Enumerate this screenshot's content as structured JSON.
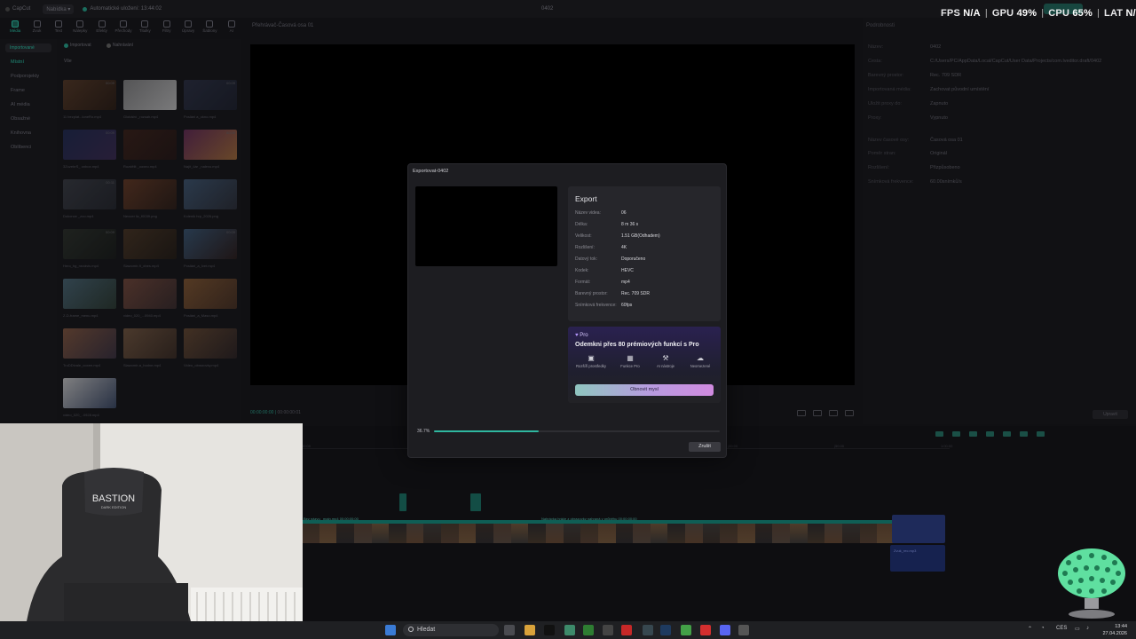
{
  "app": {
    "brand": "CapCut",
    "menu_label": "Nabídka",
    "autosave": "Automatické uložení: 13:44:02",
    "project_name": "0402"
  },
  "perf": {
    "fps_label": "FPS",
    "fps_value": "N/A",
    "gpu_label": "GPU",
    "gpu_value": "49",
    "cpu_label": "CPU",
    "cpu_value": "65",
    "lat_label": "LAT",
    "lat_value": "N/A"
  },
  "toolbar": [
    "Média",
    "Zvuk",
    "Text",
    "Nálepky",
    "Efekty",
    "Přechody",
    "Titulky",
    "Filtry",
    "Úpravy",
    "Šablony",
    "AI"
  ],
  "leftnav": {
    "pill": "Importované",
    "items": [
      "Místní",
      "Podporojekty",
      "Frame",
      "AI média",
      "Obsažné",
      "Knihovna",
      "Oblíbenci"
    ]
  },
  "media": {
    "import_label": "Importovat",
    "record_label": "Nahrávání",
    "all_label": "Vše",
    "thumbs": [
      {
        "name": "11 bezplat...loneRo.mp4",
        "dur": "00:09"
      },
      {
        "name": "Globální _rozsah.mp4",
        "dur": ""
      },
      {
        "name": "Posláni a_okno.mp4",
        "dur": "00:09"
      },
      {
        "name": "3ZozebrS_ onbox.mp4",
        "dur": "00:09"
      },
      {
        "name": "Rozdělit _ooxeo.mp4",
        "dur": ""
      },
      {
        "name": "Najít_čár _nalevo.mp4",
        "dur": "00:09"
      },
      {
        "name": "Dokonce _zoo.mp4",
        "dur": "00:11"
      },
      {
        "name": "Neocer lic_f0039.png",
        "dur": ""
      },
      {
        "name": "Kolenik hrp_2026.png",
        "dur": ""
      },
      {
        "name": "Hero_hg_nezávis.mp4",
        "dur": "00:09"
      },
      {
        "name": "Slawomir-9_dnes.mp4",
        "dur": ""
      },
      {
        "name": "Posláni_a_Ivet.mp4",
        "dur": "00:09"
      },
      {
        "name": "Z-D-frame_menu.mp4",
        "dur": ""
      },
      {
        "name": "video_020_...0940.mp4",
        "dur": ""
      },
      {
        "name": "Posláni_a_Maso.mp4",
        "dur": ""
      },
      {
        "name": "TruDDtvale_ooxee.mp4",
        "dur": ""
      },
      {
        "name": "Slawomir-a_hodne.mp4",
        "dur": ""
      },
      {
        "name": "Video_obrazovky.mp4",
        "dur": ""
      },
      {
        "name": "video_020_..0928.mp4",
        "dur": ""
      }
    ]
  },
  "player": {
    "header": "Přehrávač-Časová osa 01",
    "timecode_current": "00:00:00:00",
    "timecode_total": "00:00:00:01"
  },
  "rpanel": {
    "header": "Podrobnosti",
    "rows": [
      {
        "k": "Název:",
        "v": "0402"
      },
      {
        "k": "Cesta:",
        "v": "C:/Users/PC/AppData/Local/CapCut/User Data/Projects/com.lveditor.draft/0402"
      },
      {
        "k": "Barevný prostor:",
        "v": "Rec. 709 SDR"
      },
      {
        "k": "Importovaná média:",
        "v": "Zachovat původní umístění"
      },
      {
        "k": "Uložit proxy do:",
        "v": "Zapnuto"
      },
      {
        "k": "Proxy:",
        "v": "Vypnuto"
      },
      {
        "k": "Název časové osy:",
        "v": "Časová osa 01"
      },
      {
        "k": "Poměr stran:",
        "v": "Originál"
      },
      {
        "k": "Rozlišení:",
        "v": "Přizpůsobeno"
      },
      {
        "k": "Snímková frekvence:",
        "v": "60.00snímků/s"
      }
    ],
    "modify_button": "Upravit"
  },
  "timeline": {
    "ruler": [
      "00:00",
      "|10:00",
      "|20:00",
      "|30:00",
      "|40:00",
      "|50:00",
      "1:00:00"
    ],
    "clip_label_1": "Bez názvu _main.mp4  00:00:00:00",
    "clip_label_2": "Nahrávka hráče z obrazovky nahraná v průběhu 00:00:00:00",
    "audio_label": "Zvuk_rec.mp3"
  },
  "modal": {
    "title": "Exportovat-0402",
    "info_header": "Export",
    "rows": [
      {
        "k": "Název videa:",
        "v": "06"
      },
      {
        "k": "Délka:",
        "v": "8 m 36 s"
      },
      {
        "k": "Velikost:",
        "v": "1.51 GB(Odhadem)"
      },
      {
        "k": "Rozlišení:",
        "v": "4K"
      },
      {
        "k": "Datový tok:",
        "v": "Doporučeno"
      },
      {
        "k": "Kodek:",
        "v": "HEVC"
      },
      {
        "k": "Formát:",
        "v": "mp4"
      },
      {
        "k": "Barevný prostor:",
        "v": "Rec. 709 SDR"
      },
      {
        "k": "Snímková frekvence:",
        "v": "60fps"
      }
    ],
    "pro_badge": "Pro",
    "pro_headline": "Odemkni přes 80 prémiových funkcí s Pro",
    "features": [
      {
        "label": "Rozšíří prostředky",
        "icon": "image-icon"
      },
      {
        "label": "Funkce Pro",
        "icon": "grid-icon"
      },
      {
        "label": "AI nástroje",
        "icon": "wand-icon"
      },
      {
        "label": "Neomezené",
        "icon": "cloud-icon"
      }
    ],
    "renew_button": "Obnovit mysl",
    "progress_text": "36.7%",
    "progress_fraction": 0.367,
    "cancel_button": "Zrušit"
  },
  "webcam": {
    "chair_brand": "BASTION",
    "chair_sub": "DARK EDITION"
  },
  "taskbar": {
    "search_label": "Hledat",
    "lang": "CES",
    "time": "13:44",
    "date": "27.04.2026"
  },
  "colors": {
    "accent": "#2fb7a0",
    "pro_purple": "#b598ff"
  }
}
